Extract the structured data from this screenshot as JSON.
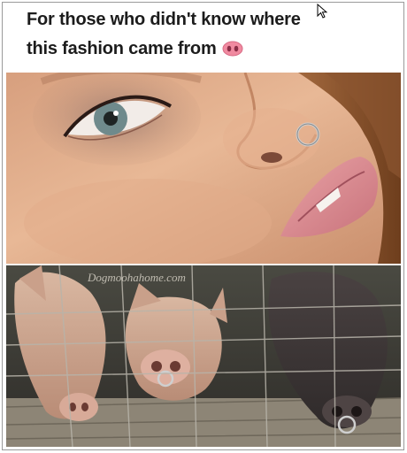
{
  "post": {
    "caption_line1": "For those who didn't know where",
    "caption_line2": "this fashion came from",
    "caption_emoji": "pig-nose-emoji"
  },
  "bottom_image": {
    "watermark": "Dogmoohahome.com"
  },
  "colors": {
    "caption_text": "#1c1c1c",
    "pig_nose_emoji": "#f08aa0",
    "frame_border": "#9a9a9a"
  }
}
